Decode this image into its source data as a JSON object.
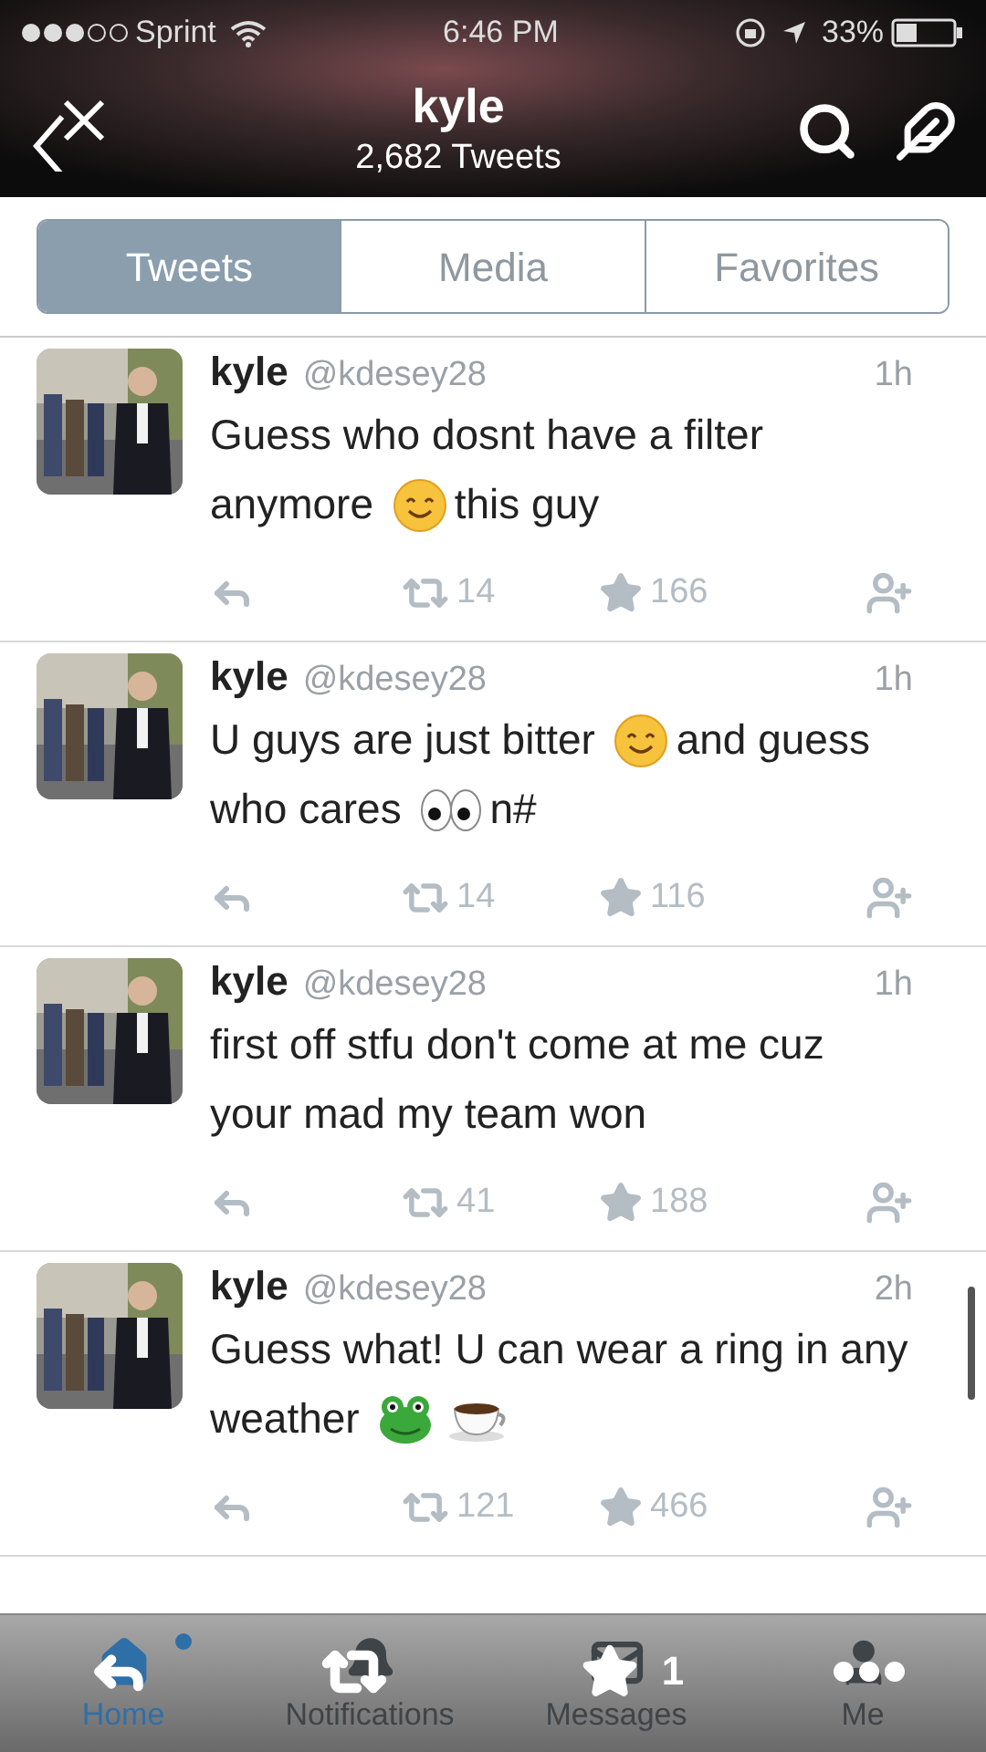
{
  "status_bar": {
    "carrier": "Sprint",
    "time": "6:46 PM",
    "battery": "33%"
  },
  "header": {
    "title": "kyle",
    "subtitle": "2,682 Tweets"
  },
  "tabs": [
    {
      "label": "Tweets",
      "selected": true
    },
    {
      "label": "Media",
      "selected": false
    },
    {
      "label": "Favorites",
      "selected": false
    }
  ],
  "tweets": [
    {
      "name": "kyle",
      "handle": "@kdesey28",
      "time": "1h",
      "text": [
        {
          "kind": "text",
          "text": "Guess who dosnt have a filter anymore"
        },
        {
          "kind": "smile"
        },
        {
          "kind": "text",
          "text": "this guy"
        }
      ],
      "retweets": "14",
      "favorites": "166"
    },
    {
      "name": "kyle",
      "handle": "@kdesey28",
      "time": "1h",
      "text": [
        {
          "kind": "text",
          "text": "U guys are just bitter"
        },
        {
          "kind": "smile"
        },
        {
          "kind": "text",
          "text": "and guess who cares"
        },
        {
          "kind": "eyes"
        },
        {
          "kind": "text",
          "text": "n#"
        }
      ],
      "retweets": "14",
      "favorites": "116"
    },
    {
      "name": "kyle",
      "handle": "@kdesey28",
      "time": "1h",
      "text": [
        {
          "kind": "text",
          "text": "first off stfu don't come at me cuz your mad my team won"
        }
      ],
      "retweets": "41",
      "favorites": "188"
    },
    {
      "name": "kyle",
      "handle": "@kdesey28",
      "time": "2h",
      "text": [
        {
          "kind": "text",
          "text": "Guess what! U can wear a ring in any weather"
        },
        {
          "kind": "frog"
        },
        {
          "kind": "cup"
        }
      ],
      "retweets": "121",
      "favorites": "466"
    }
  ],
  "tab_bar": [
    {
      "kind": "home",
      "label": "Home",
      "selected": true,
      "unread": true
    },
    {
      "kind": "notifications",
      "label": "Notifications",
      "selected": false,
      "unread": false
    },
    {
      "kind": "messages",
      "label": "Messages",
      "selected": false,
      "unread": false
    },
    {
      "kind": "me",
      "label": "Me",
      "selected": false,
      "unread": false
    }
  ],
  "overlay": {
    "favorite_count": "1"
  }
}
